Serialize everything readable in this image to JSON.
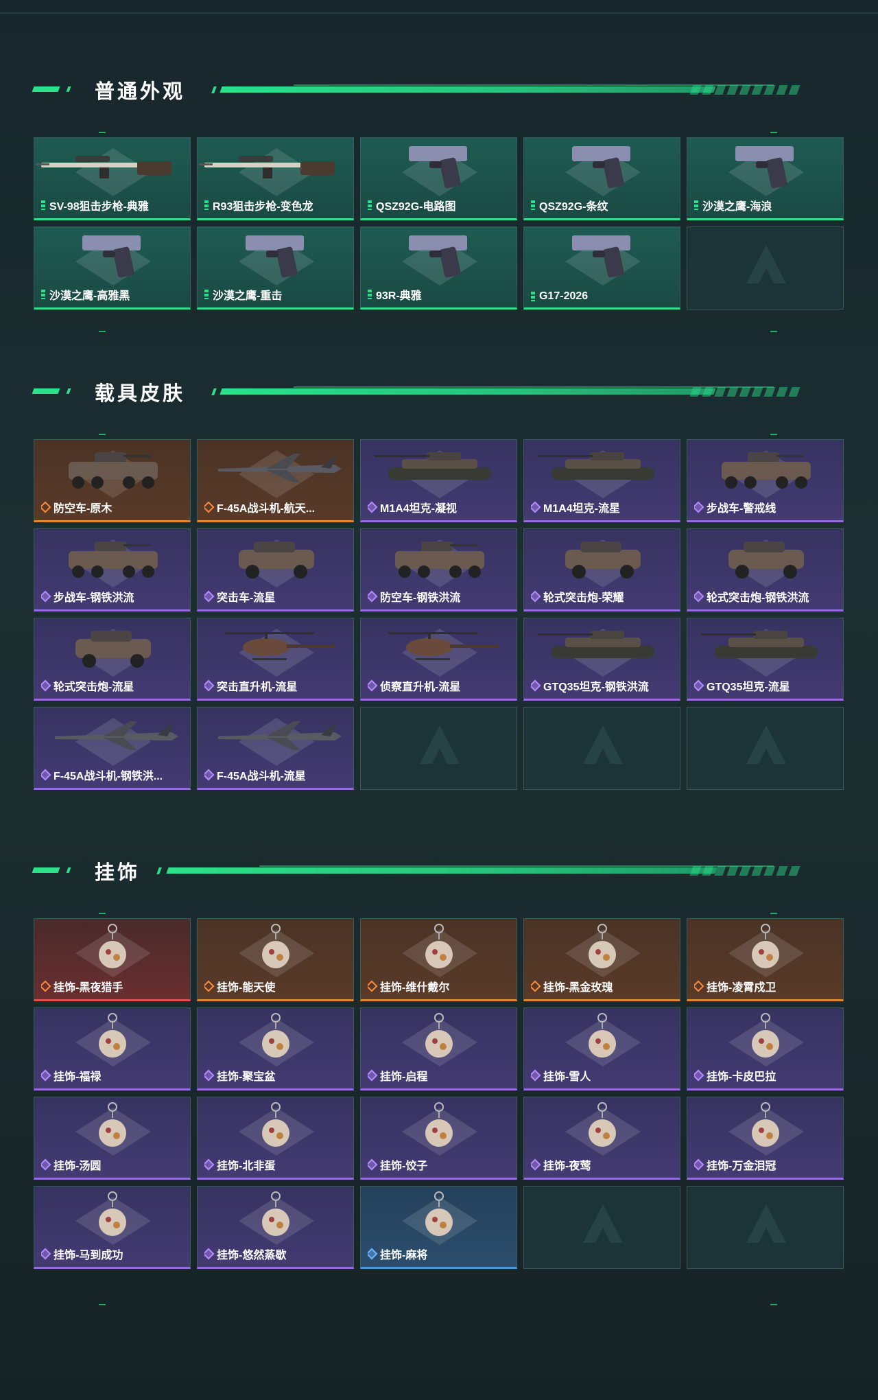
{
  "sections": [
    {
      "title": "普通外观",
      "items": [
        {
          "label": "SV-98狙击步枪-典雅",
          "rarity": "green",
          "icon": "sniper-rifle-icon"
        },
        {
          "label": "R93狙击步枪-变色龙",
          "rarity": "green",
          "icon": "sniper-rifle-icon"
        },
        {
          "label": "QSZ92G-电路图",
          "rarity": "green",
          "icon": "pistol-icon"
        },
        {
          "label": "QSZ92G-条纹",
          "rarity": "green",
          "icon": "pistol-icon"
        },
        {
          "label": "沙漠之鹰-海浪",
          "rarity": "green",
          "icon": "pistol-icon"
        },
        {
          "label": "沙漠之鹰-高雅黑",
          "rarity": "green",
          "icon": "pistol-icon"
        },
        {
          "label": "沙漠之鹰-重击",
          "rarity": "green",
          "icon": "pistol-icon"
        },
        {
          "label": "93R-典雅",
          "rarity": "green",
          "icon": "pistol-icon"
        },
        {
          "label": "G17-2026",
          "rarity": "green",
          "icon": "pistol-icon"
        },
        {
          "label": "",
          "rarity": "empty",
          "icon": "logo-placeholder-icon"
        }
      ]
    },
    {
      "title": "载具皮肤",
      "items": [
        {
          "label": "防空车-原木",
          "rarity": "orange",
          "icon": "armored-vehicle-icon"
        },
        {
          "label": "F-45A战斗机-航天...",
          "rarity": "orange",
          "icon": "fighter-jet-icon"
        },
        {
          "label": "M1A4坦克-凝视",
          "rarity": "purple",
          "icon": "tank-icon"
        },
        {
          "label": "M1A4坦克-流星",
          "rarity": "purple",
          "icon": "tank-icon"
        },
        {
          "label": "步战车-警戒线",
          "rarity": "purple",
          "icon": "armored-vehicle-icon"
        },
        {
          "label": "步战车-钢铁洪流",
          "rarity": "purple",
          "icon": "armored-vehicle-icon"
        },
        {
          "label": "突击车-流星",
          "rarity": "purple",
          "icon": "assault-car-icon"
        },
        {
          "label": "防空车-钢铁洪流",
          "rarity": "purple",
          "icon": "armored-vehicle-icon"
        },
        {
          "label": "轮式突击炮-荣耀",
          "rarity": "purple",
          "icon": "assault-car-icon"
        },
        {
          "label": "轮式突击炮-钢铁洪流",
          "rarity": "purple",
          "icon": "assault-car-icon"
        },
        {
          "label": "轮式突击炮-流星",
          "rarity": "purple",
          "icon": "assault-car-icon"
        },
        {
          "label": "突击直升机-流星",
          "rarity": "purple",
          "icon": "helicopter-icon"
        },
        {
          "label": "侦察直升机-流星",
          "rarity": "purple",
          "icon": "helicopter-icon"
        },
        {
          "label": "GTQ35坦克-钢铁洪流",
          "rarity": "purple",
          "icon": "tank-icon"
        },
        {
          "label": "GTQ35坦克-流星",
          "rarity": "purple",
          "icon": "tank-icon"
        },
        {
          "label": "F-45A战斗机-钢铁洪...",
          "rarity": "purple",
          "icon": "fighter-jet-icon"
        },
        {
          "label": "F-45A战斗机-流星",
          "rarity": "purple",
          "icon": "fighter-jet-icon"
        },
        {
          "label": "",
          "rarity": "empty",
          "icon": "logo-placeholder-icon"
        },
        {
          "label": "",
          "rarity": "empty",
          "icon": "logo-placeholder-icon"
        },
        {
          "label": "",
          "rarity": "empty",
          "icon": "logo-placeholder-icon"
        }
      ]
    },
    {
      "title": "挂饰",
      "items": [
        {
          "label": "挂饰-黑夜猎手",
          "rarity": "red",
          "icon": "charm-icon"
        },
        {
          "label": "挂饰-能天使",
          "rarity": "orange",
          "icon": "charm-icon"
        },
        {
          "label": "挂饰-维什戴尔",
          "rarity": "orange",
          "icon": "charm-icon"
        },
        {
          "label": "挂饰-黑金玫瑰",
          "rarity": "orange",
          "icon": "charm-icon"
        },
        {
          "label": "挂饰-凌霄戍卫",
          "rarity": "orange",
          "icon": "charm-icon"
        },
        {
          "label": "挂饰-福禄",
          "rarity": "purple",
          "icon": "charm-icon"
        },
        {
          "label": "挂饰-聚宝盆",
          "rarity": "purple",
          "icon": "charm-icon"
        },
        {
          "label": "挂饰-启程",
          "rarity": "purple",
          "icon": "charm-icon"
        },
        {
          "label": "挂饰-雪人",
          "rarity": "purple",
          "icon": "charm-icon"
        },
        {
          "label": "挂饰-卡皮巴拉",
          "rarity": "purple",
          "icon": "charm-icon"
        },
        {
          "label": "挂饰-汤圆",
          "rarity": "purple",
          "icon": "charm-icon"
        },
        {
          "label": "挂饰-北非蛋",
          "rarity": "purple",
          "icon": "charm-icon"
        },
        {
          "label": "挂饰-饺子",
          "rarity": "purple",
          "icon": "charm-icon"
        },
        {
          "label": "挂饰-夜莺",
          "rarity": "purple",
          "icon": "charm-icon"
        },
        {
          "label": "挂饰-万金泪冠",
          "rarity": "purple",
          "icon": "charm-icon"
        },
        {
          "label": "挂饰-马到成功",
          "rarity": "purple",
          "icon": "charm-icon"
        },
        {
          "label": "挂饰-悠然蒸歇",
          "rarity": "purple",
          "icon": "charm-icon"
        },
        {
          "label": "挂饰-麻将",
          "rarity": "blue",
          "icon": "charm-icon"
        },
        {
          "label": "",
          "rarity": "empty",
          "icon": "logo-placeholder-icon"
        },
        {
          "label": "",
          "rarity": "empty",
          "icon": "logo-placeholder-icon"
        }
      ]
    }
  ],
  "colors": {
    "accent": "#2de08a",
    "green": "#2de08a",
    "orange": "#e08a2d",
    "red": "#e05050",
    "purple": "#9a6ae0",
    "blue": "#4a9ae0"
  }
}
